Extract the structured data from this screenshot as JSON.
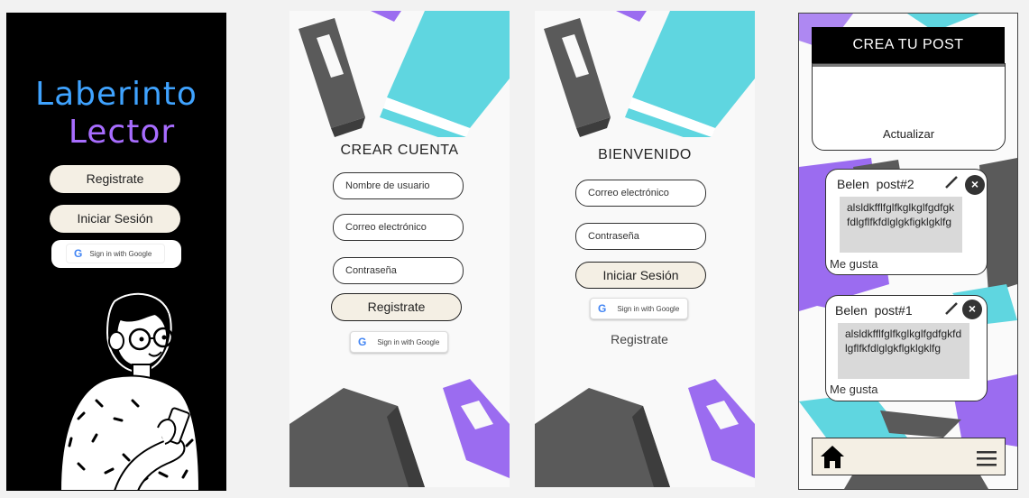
{
  "screen1": {
    "logo_line1": "Laberinto",
    "logo_line2": "Lector",
    "register_label": "Registrate",
    "login_label": "Iniciar Sesión",
    "google_label": "Sign in with Google"
  },
  "screen2": {
    "title": "CREAR CUENTA",
    "username_placeholder": "Nombre de usuario",
    "email_placeholder": "Correo electrónico",
    "password_placeholder": "Contraseña",
    "register_label": "Registrate",
    "google_label": "Sign in with Google"
  },
  "screen3": {
    "title": "BIENVENIDO",
    "email_placeholder": "Correo electrónico",
    "password_placeholder": "Contraseña",
    "login_label": "Iniciar Sesión",
    "google_label": "Sign in with Google",
    "register_link": "Registrate"
  },
  "screen4": {
    "header": "CREA TU POST",
    "update_label": "Actualizar",
    "posts": [
      {
        "user": "Belen",
        "title": "post#2",
        "text": "alsldkfflfglfkglkglfgdfgkfdlgflfkfdlglgkfigklgklfg",
        "like_label": "Me gusta"
      },
      {
        "user": "Belen",
        "title": "post#1",
        "text": "alsldkfflfglfkglkglfgdfgkfdlgflfkfdlglgkflgklgklfg",
        "like_label": "Me gusta"
      }
    ]
  },
  "colors": {
    "blue_logo": "#3fa3ff",
    "purple_logo": "#a86dff",
    "teal_book": "#5fd6e0",
    "purple_book": "#9b6cf0",
    "gray_book": "#5a5a5a",
    "beige": "#f4efe4"
  },
  "icons": [
    "google-g-icon",
    "pencil-icon",
    "close-icon",
    "home-icon",
    "menu-icon",
    "book-icon",
    "girl-illustration"
  ]
}
